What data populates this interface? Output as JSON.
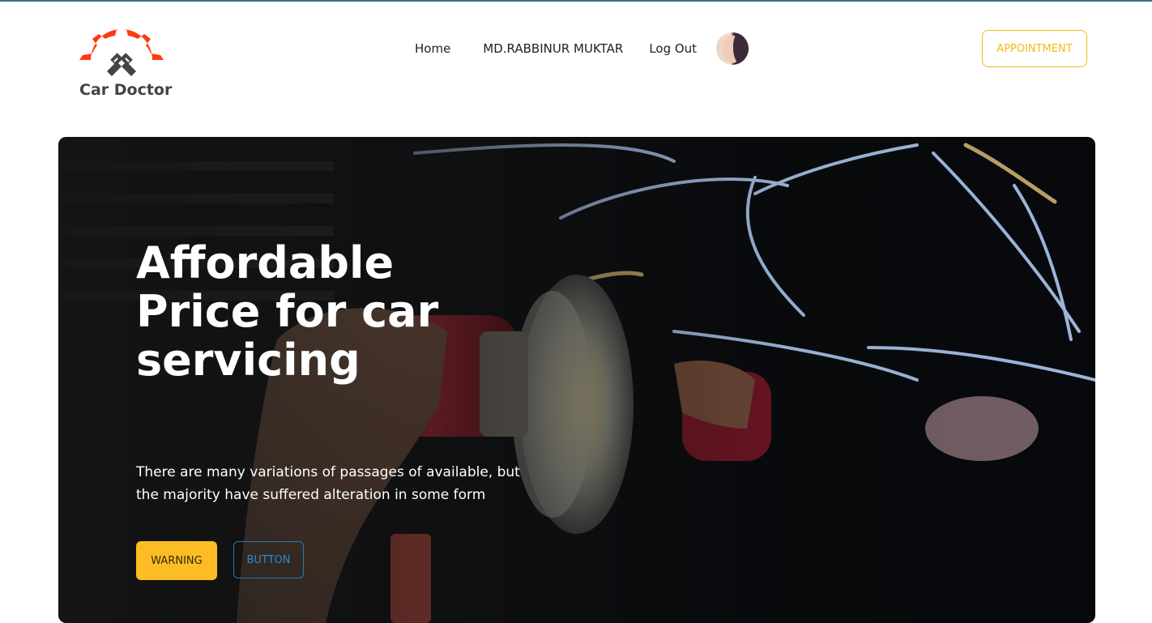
{
  "brand": {
    "name": "Car Doctor",
    "logo_icon": "gear-piston-icon",
    "logo_color": "#ff3811"
  },
  "nav": {
    "items": [
      {
        "label": "Home"
      },
      {
        "label": "MD.RABBINUR MUKTAR"
      },
      {
        "label": "Log Out"
      }
    ],
    "avatar_icon": "user-avatar"
  },
  "appointment": {
    "label": "APPOINTMENT",
    "color": "#f5b818"
  },
  "hero": {
    "title": "Affordable Price for car servicing",
    "description": "There are many variations of passages of available, but the majority have suffered alteration in some form",
    "buttons": [
      {
        "label": "WARNING",
        "color": "#fbbd23"
      },
      {
        "label": "BUTTON",
        "color": "#1f7bb6"
      }
    ]
  }
}
